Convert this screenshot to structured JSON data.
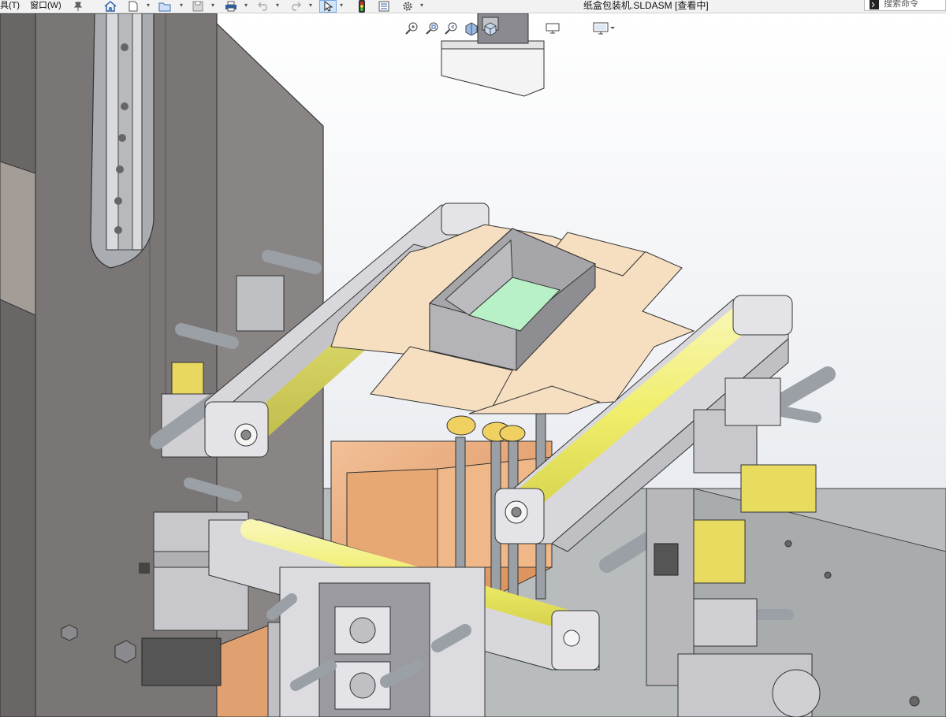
{
  "menu": {
    "tools_label": "具(T)",
    "window_label": "窗口(W)"
  },
  "toolbar": {
    "icons": [
      "pin-icon",
      "home-icon",
      "new-document-icon",
      "open-folder-icon",
      "save-icon",
      "print-icon",
      "undo-icon",
      "redo-icon",
      "select-cursor-icon",
      "rebuild-traffic-light-icon",
      "file-properties-icon",
      "options-gear-icon"
    ]
  },
  "document": {
    "title": "纸盒包装机.SLDASM [查看中]"
  },
  "search": {
    "placeholder": "搜索命令"
  },
  "heads_up_toolbar": {
    "icons": [
      "zoom-to-fit-icon",
      "zoom-to-area-icon",
      "previous-view-icon",
      "section-view-icon",
      "view-orientation-icon",
      "display-style-icon",
      "display-settings-icon"
    ]
  },
  "model": {
    "name": "纸盒包装机",
    "colors": {
      "frame_gray": "#c8c8cc",
      "dark_panel": "#7a7676",
      "yellow_roller": "#f4f27a",
      "cardboard": "#f6dfc0",
      "copper_plate": "#e0a070",
      "green_bottom": "#b8f0c8",
      "brass": "#f0d060"
    }
  }
}
